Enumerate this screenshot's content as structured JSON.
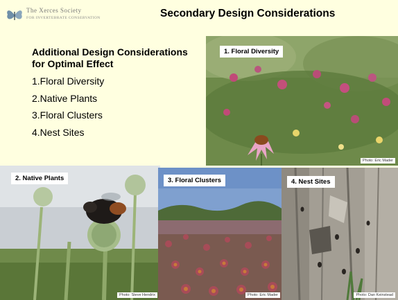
{
  "header": {
    "org_name": "The Xerces Society",
    "org_tagline": "FOR INVERTEBRATE CONSERVATION",
    "title": "Secondary Design Considerations"
  },
  "content": {
    "heading": "Additional Design Considerations for Optimal Effect",
    "items": [
      "1.Floral Diversity",
      "2.Native Plants",
      "3.Floral Clusters",
      "4.Nest Sites"
    ]
  },
  "photos": [
    {
      "label": "1. Floral Diversity",
      "credit": "Photo: Eric Mader"
    },
    {
      "label": "2. Native Plants",
      "credit": "Photo: Steve Hendrix"
    },
    {
      "label": "3. Floral Clusters",
      "credit": "Photo: Eric Mader"
    },
    {
      "label": "4. Nest Sites",
      "credit": "Photo: Dan Keinstead"
    }
  ],
  "colors": {
    "background": "#FFFFE0",
    "title_text": "#000000"
  }
}
